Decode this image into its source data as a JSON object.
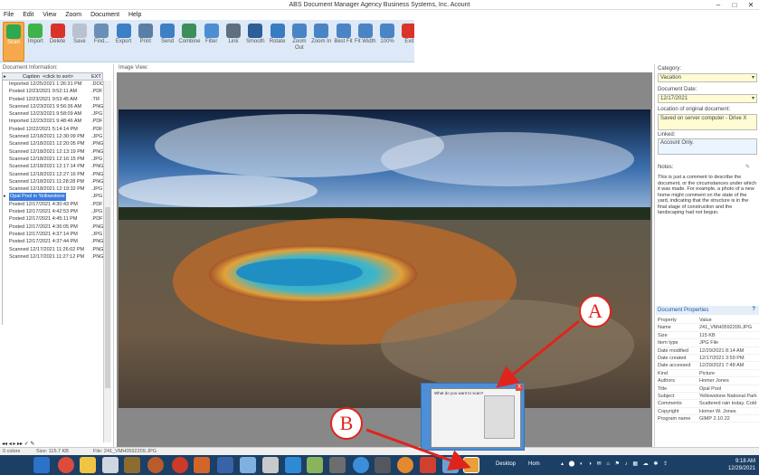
{
  "window": {
    "title": "ABS Document Manager     Agency Business Systems, Inc. Acount"
  },
  "menu": [
    "File",
    "Edit",
    "View",
    "Zoom",
    "Document",
    "Help"
  ],
  "toolbar": [
    {
      "label": "Scan",
      "icon": "scan-icon",
      "color": "#2fa84f"
    },
    {
      "label": "Import",
      "icon": "import-icon",
      "color": "#3fb24a"
    },
    {
      "label": "Delete",
      "icon": "delete-icon",
      "color": "#d9342b"
    },
    {
      "label": "Save",
      "icon": "save-icon",
      "color": "#b9c3cf"
    },
    {
      "label": "Find...",
      "icon": "find-icon",
      "color": "#6b8fb7"
    },
    {
      "label": "Export",
      "icon": "export-icon",
      "color": "#3c7fc6"
    },
    {
      "label": "Print",
      "icon": "print-icon",
      "color": "#5a7ea6"
    },
    {
      "label": "Send",
      "icon": "send-icon",
      "color": "#3e7fc5"
    },
    {
      "label": "Combine",
      "icon": "combine-icon",
      "color": "#3c8f5a"
    },
    {
      "label": "Filter",
      "icon": "filter-icon",
      "color": "#4d8ed3"
    },
    {
      "label": "Link",
      "icon": "link-icon",
      "color": "#5f6f80"
    },
    {
      "label": "Smooth",
      "icon": "smooth-icon",
      "color": "#2f5d97"
    },
    {
      "label": "Rotate",
      "icon": "rotate-icon",
      "color": "#3a7cc1"
    },
    {
      "label": "Zoom Out",
      "icon": "zoom-out-icon",
      "color": "#4a84c5"
    },
    {
      "label": "Zoom In",
      "icon": "zoom-in-icon",
      "color": "#4a84c5"
    },
    {
      "label": "Best Fit",
      "icon": "best-fit-icon",
      "color": "#4a84c5"
    },
    {
      "label": "Fit Width",
      "icon": "fit-width-icon",
      "color": "#4a84c5"
    },
    {
      "label": "100%",
      "icon": "zoom-100-icon",
      "color": "#4a84c5"
    },
    {
      "label": "Exit",
      "icon": "exit-icon",
      "color": "#d9342b"
    }
  ],
  "doc_panel": {
    "title": "Document Information:",
    "col_caption": "Caption",
    "col_sort": "<click to sort>",
    "col_ext": "EXT",
    "rows": [
      {
        "caption": "Imported 12/25/2021 1:26:31 PM",
        "ext": "DOC"
      },
      {
        "caption": "Posted 12/23/2021 9:52:11 AM",
        "ext": "PDF"
      },
      {
        "caption": "Posted 12/23/2021 9:53:45 AM",
        "ext": "TIF"
      },
      {
        "caption": "Scanned 12/23/2021 9:56:36 AM",
        "ext": "PNG"
      },
      {
        "caption": "Scanned 12/23/2021 9:58:09 AM",
        "ext": "JPG"
      },
      {
        "caption": "Imported 12/23/2021 9:48:46 AM",
        "ext": "PDF"
      },
      {
        "caption": "Posted 12/22/2021 5:14:14 PM",
        "ext": "PDF"
      },
      {
        "caption": "Scanned 12/18/2021 12:30:09 PM",
        "ext": "JPG"
      },
      {
        "caption": "Scanned 12/18/2021 12:20:05 PM",
        "ext": "PNG"
      },
      {
        "caption": "Scanned 12/18/2021 12:13:19 PM",
        "ext": "PNG"
      },
      {
        "caption": "Scanned 12/18/2021 12:16:15 PM",
        "ext": "JPG"
      },
      {
        "caption": "Scanned 12/18/2021 12:17:14 PM",
        "ext": "PNG"
      },
      {
        "caption": "Scanned 12/18/2021 12:27:16 PM",
        "ext": "PNG"
      },
      {
        "caption": "Scanned 12/18/2021 11:28:28 PM",
        "ext": "PNG"
      },
      {
        "caption": "Scanned 12/18/2021 12:19:32 PM",
        "ext": "JPG"
      },
      {
        "caption": "Opal Pool in Yellowstone",
        "ext": "JPG",
        "selected": true
      },
      {
        "caption": "Posted 12/17/2021 4:30:43 PM",
        "ext": "PDF"
      },
      {
        "caption": "Posted 12/17/2021 4:42:53 PM",
        "ext": "JPG"
      },
      {
        "caption": "Posted 12/17/2021 4:45:11 PM",
        "ext": "PDF"
      },
      {
        "caption": "Posted 12/17/2021 4:36:05 PM",
        "ext": "PNG"
      },
      {
        "caption": "Posted 12/17/2021 4:37:14 PM",
        "ext": "JPG"
      },
      {
        "caption": "Posted 12/17/2021 4:37:44 PM",
        "ext": "PNG"
      },
      {
        "caption": "Scanned 12/17/2021 11:26:02 PM",
        "ext": "PNG"
      },
      {
        "caption": "Scanned 12/17/2021 11:27:12 PM",
        "ext": "PNG"
      }
    ]
  },
  "image_view": {
    "title": "Image View:"
  },
  "right_panel": {
    "category_label": "Category:",
    "category_value": "Vacation",
    "date_label": "Document Date:",
    "date_value": "12/17/2021",
    "location_label": "Location of original document:",
    "location_value": "Saved on server computer - Drive X",
    "linked_label": "Linked:",
    "linked_value": "Account Only.",
    "notes_label": "Notes:",
    "notes_text": "This is just a comment to describe the document, or the circumstances under which it was made. For example, a photo of a new home might comment on the state of the yard, indicating that the structure is in the final stage of construction and the landscaping had not begun."
  },
  "properties": {
    "title": "Document Properties",
    "help": "?",
    "header_key": "Property",
    "header_value": "Value",
    "rows": [
      {
        "k": "Name",
        "v": "241_VMH0592209.JPG"
      },
      {
        "k": "Size",
        "v": "115 KB"
      },
      {
        "k": "Item type",
        "v": "JPG File"
      },
      {
        "k": "Date modified",
        "v": "12/29/2021 8:14 AM"
      },
      {
        "k": "Date created",
        "v": "12/17/2021 3:59 PM"
      },
      {
        "k": "Date accessed",
        "v": "12/29/2021 7:48 AM"
      },
      {
        "k": "Kind",
        "v": "Picture"
      },
      {
        "k": "Authors",
        "v": "Homer Jones"
      },
      {
        "k": "Title",
        "v": "Opal Pool"
      },
      {
        "k": "Subject",
        "v": "Yellowstone National Park"
      },
      {
        "k": "Comments",
        "v": "Scattered rain today. Cold"
      },
      {
        "k": "Copyright",
        "v": "Homer W. Jones"
      },
      {
        "k": "Program name",
        "v": "GIMP 2.10.22"
      }
    ]
  },
  "status": {
    "colors": "0 colors",
    "size": "Size: 115.7 KB",
    "file": "File: 241_VMH0592209.JPG"
  },
  "popup": {
    "title": "What do you want to scan?",
    "close": "X"
  },
  "callouts": {
    "a": "A",
    "b": "B"
  },
  "taskbar": {
    "desktop_label": "Desktop",
    "home_label": "Hom",
    "time": "9:18 AM",
    "date": "12/29/2021"
  }
}
